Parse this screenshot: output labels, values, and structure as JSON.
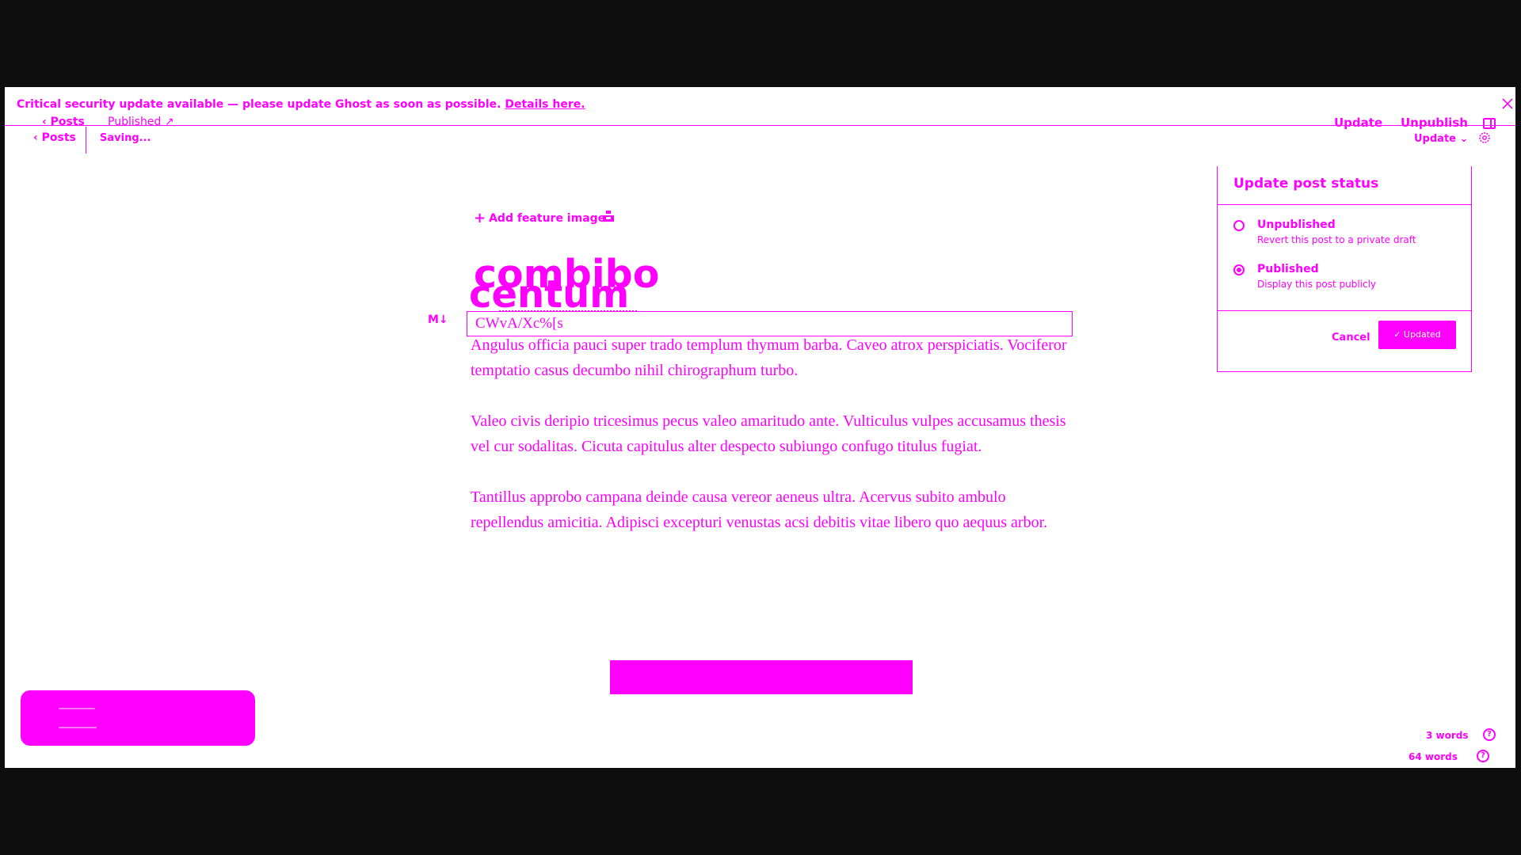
{
  "banner": {
    "text": "Critical security update available — please update Ghost as soon as possible.",
    "link": "Details here."
  },
  "ghost_header": {
    "posts": "Posts",
    "published": "Published",
    "update": "Update",
    "unpublish": "Unpublish"
  },
  "header": {
    "back_label": "Posts",
    "status": "Saving...",
    "update_dropdown": "Update"
  },
  "editor": {
    "add_feature_image": "Add feature image",
    "title_primary": "combibo",
    "title_shadow": "centum",
    "markdown_badge": "M↓",
    "excerpt": "CWvA/Xc%[s",
    "paragraphs": [
      "Angulus officia pauci super trado templum thymum barba. Caveo atrox perspiciatis. Vociferor temptatio casus decumbo nihil chirographum turbo.",
      "Valeo civis deripio tricesimus pecus valeo amaritudo ante. Vulticulus vulpes accusamus thesis vel cur sodalitas. Cicuta capitulus alter despecto subiungo confugo titulus fugiat.",
      "Tantillus approbo campana deinde causa vereor aeneus ultra. Acervus subito ambulo repellendus amicitia. Adipisci excepturi venustas acsi debitis vitae libero quo aequus arbor."
    ]
  },
  "status_panel": {
    "title": "Update post status",
    "options": [
      {
        "label": "Unpublished",
        "description": "Revert this post to a private draft",
        "selected": false
      },
      {
        "label": "Published",
        "description": "Display this post publicly",
        "selected": true
      }
    ],
    "cancel": "Cancel",
    "confirm": "✓ Updated"
  },
  "word_counts": {
    "top": "3 words",
    "bottom": "64 words"
  },
  "colors": {
    "accent": "#ff00ff",
    "background": "#ffffff",
    "outer": "#0e0e0e"
  }
}
